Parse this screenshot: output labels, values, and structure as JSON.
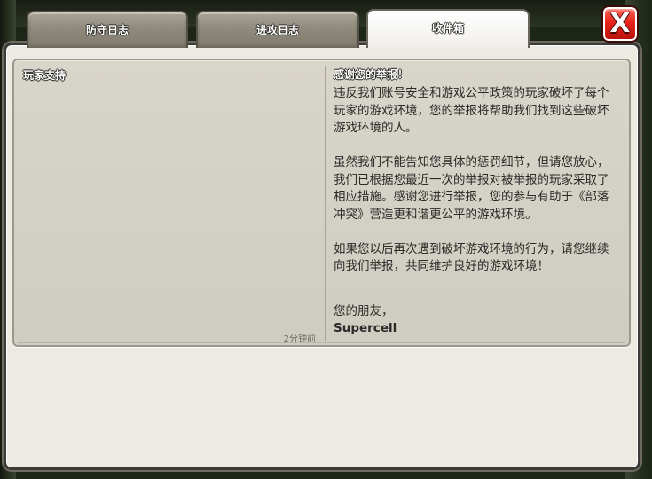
{
  "tabs": [
    {
      "label": "防守日志",
      "active": false
    },
    {
      "label": "进攻日志",
      "active": false
    },
    {
      "label": "收件箱",
      "active": true
    }
  ],
  "close_button": {
    "label": "X"
  },
  "message": {
    "sender": "玩家支持",
    "timestamp": "2分钟前",
    "subject": "感谢您的举报！",
    "paragraphs": [
      "违反我们账号安全和游戏公平政策的玩家破坏了每个玩家的游戏环境，您的举报将帮助我们找到这些破坏游戏环境的人。",
      "虽然我们不能告知您具体的惩罚细节，但请您放心，我们已根据您最近一次的举报对被举报的玩家采取了相应措施。感谢您进行举报，您的参与有助于《部落冲突》营造更和谐更公平的游戏环境。",
      "如果您以后再次遇到破坏游戏环境的行为，请您继续向我们举报，共同维护良好的游戏环境！"
    ],
    "closing": "您的朋友，",
    "signature": "Supercell"
  },
  "colors": {
    "close_red": "#e8231c",
    "panel_bg": "#d8d5cb",
    "window_bg": "#edeae3"
  }
}
